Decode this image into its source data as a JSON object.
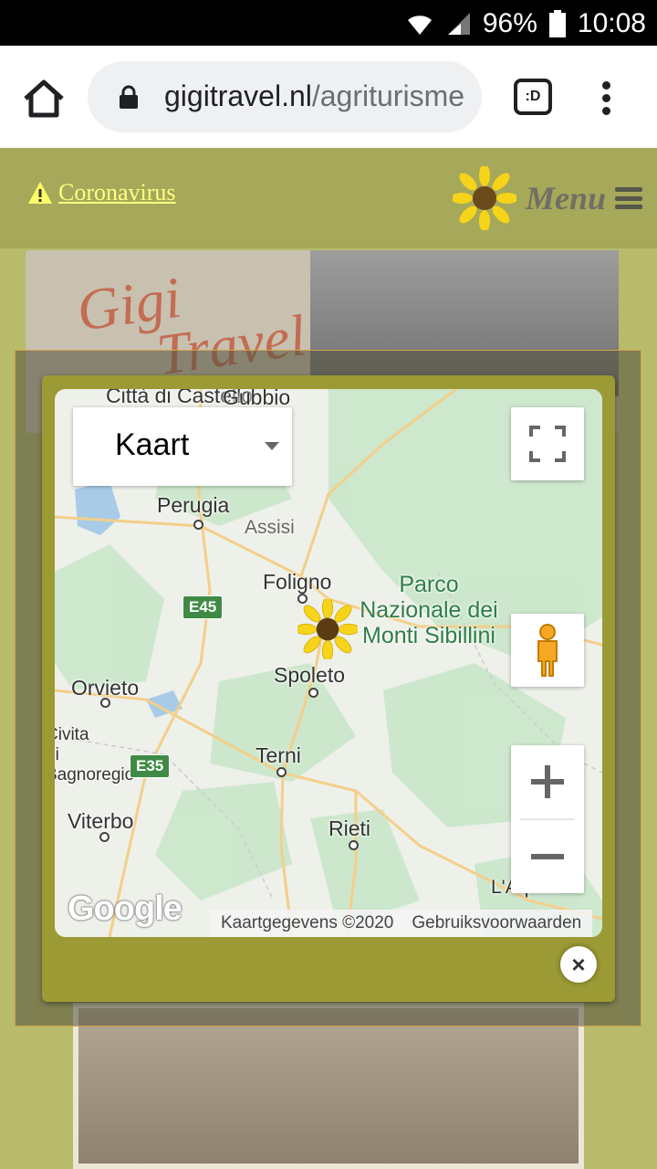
{
  "status_bar": {
    "battery": "96%",
    "time": "10:08",
    "network": "R"
  },
  "browser": {
    "url_domain": "gigitravel.nl",
    "url_path": "/agriturisme",
    "tab_switcher_label": ":D"
  },
  "site_header": {
    "alert_link": "Coronavirus",
    "menu_label": "Menu"
  },
  "background": {
    "logo_line1": "Gigi",
    "logo_line2": "Travel"
  },
  "map": {
    "map_type_selected": "Kaart",
    "places": [
      {
        "name": "Città di Castello"
      },
      {
        "name": "Gubbio"
      },
      {
        "name": "Perugia"
      },
      {
        "name": "Assisi"
      },
      {
        "name": "Foligno"
      },
      {
        "name": "Spoleto"
      },
      {
        "name": "Orvieto"
      },
      {
        "name": "Civita di Bagnoregio"
      },
      {
        "name": "Terni"
      },
      {
        "name": "Viterbo"
      },
      {
        "name": "Rieti"
      },
      {
        "name": "L'Aquila"
      }
    ],
    "park_label": "Parco Nazionale dei Monti Sibillini",
    "road_badges": [
      "E45",
      "E35"
    ],
    "copyright": "Kaartgegevens ©2020",
    "terms_link": "Gebruiksvoorwaarden",
    "attribution_logo": "Google",
    "controls": {
      "zoom_in": "+",
      "zoom_out": "−"
    }
  },
  "modal": {
    "close_label": "×"
  }
}
